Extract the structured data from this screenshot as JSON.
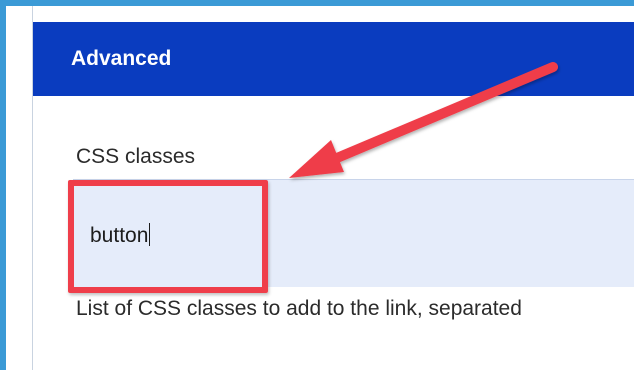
{
  "panel": {
    "title": "Advanced"
  },
  "field": {
    "label": "CSS classes",
    "value": "button",
    "help": "List of CSS classes to add to the link, separated"
  },
  "annotation": {
    "color": "#ef3e4a",
    "shape": "arrow-and-box"
  },
  "colors": {
    "header_bg": "#0a3cbf",
    "frame": "#3b9ad6",
    "input_bg": "#e5ecfa"
  }
}
